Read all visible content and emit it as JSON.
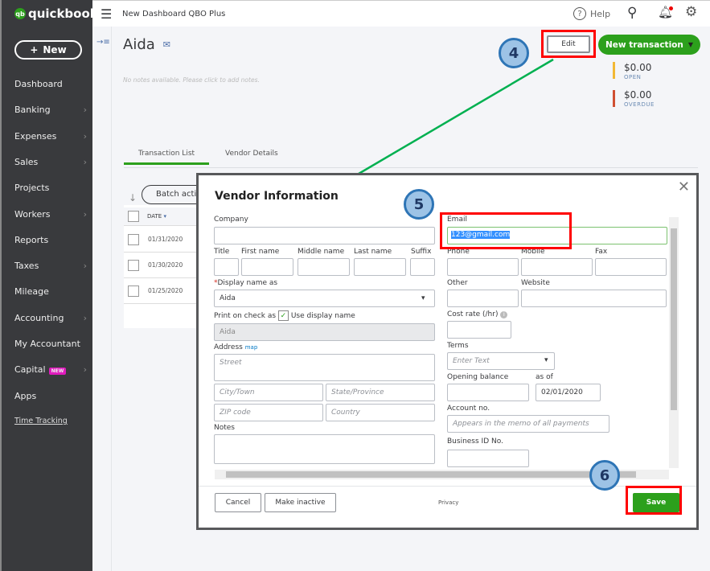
{
  "sidebar": {
    "logo_small": "intuit",
    "logo": "quickbooks",
    "new_label": "New",
    "items": [
      {
        "label": "Dashboard",
        "chevron": false
      },
      {
        "label": "Banking",
        "chevron": true
      },
      {
        "label": "Expenses",
        "chevron": true
      },
      {
        "label": "Sales",
        "chevron": true
      },
      {
        "label": "Projects",
        "chevron": false
      },
      {
        "label": "Workers",
        "chevron": true
      },
      {
        "label": "Reports",
        "chevron": false
      },
      {
        "label": "Taxes",
        "chevron": true
      },
      {
        "label": "Mileage",
        "chevron": false
      },
      {
        "label": "Accounting",
        "chevron": true
      },
      {
        "label": "My Accountant",
        "chevron": false
      },
      {
        "label": "Capital",
        "chevron": true,
        "badge": "NEW"
      },
      {
        "label": "Apps",
        "chevron": false
      }
    ],
    "time_tracking": "Time Tracking"
  },
  "topbar": {
    "company": "New Dashboard QBO Plus",
    "help": "Help"
  },
  "vendor": {
    "name": "Aida",
    "notes_placeholder": "No notes available. Please click to add notes.",
    "edit": "Edit",
    "new_transaction": "New transaction",
    "open_amount": "$0.00",
    "open_label": "OPEN",
    "overdue_amount": "$0.00",
    "overdue_label": "OVERDUE",
    "open_color": "#f2b835",
    "overdue_color": "#d04f32"
  },
  "tabs": [
    "Transaction List",
    "Vendor Details"
  ],
  "table": {
    "batch": "Batch acti",
    "date_header": "DATE",
    "rows": [
      "01/31/2020",
      "01/30/2020",
      "01/25/2020"
    ]
  },
  "modal": {
    "title": "Vendor Information",
    "company": "Company",
    "title_lbl": "Title",
    "first": "First name",
    "middle": "Middle name",
    "last": "Last name",
    "suffix": "Suffix",
    "display": "Display name as",
    "display_value": "Aida",
    "print": "Print on check as",
    "use_display": "Use display name",
    "print_value": "Aida",
    "address": "Address",
    "map": "map",
    "street": "Street",
    "city": "City/Town",
    "state": "State/Province",
    "zip": "ZIP code",
    "country": "Country",
    "notes": "Notes",
    "email": "Email",
    "email_value": "123@gmail.com",
    "phone": "Phone",
    "mobile": "Mobile",
    "fax": "Fax",
    "other": "Other",
    "website": "Website",
    "cost_rate": "Cost rate (/hr)",
    "terms": "Terms",
    "terms_placeholder": "Enter Text",
    "opening": "Opening balance",
    "as_of": "as of",
    "as_of_value": "02/01/2020",
    "account": "Account no.",
    "account_placeholder": "Appears in the memo of all payments",
    "business_id": "Business ID No.",
    "cancel": "Cancel",
    "inactive": "Make inactive",
    "privacy": "Privacy",
    "save": "Save"
  },
  "callouts": [
    "4",
    "5",
    "6"
  ],
  "colors": {
    "brand_green": "#2ca01c",
    "sidebar": "#393a3d",
    "annotation_red": "#ff0000",
    "arrow_green": "#00b050"
  }
}
